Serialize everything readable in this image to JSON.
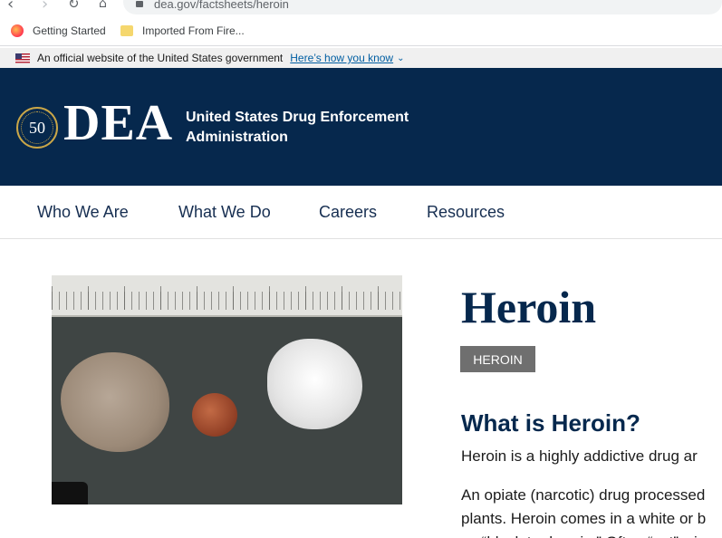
{
  "browser": {
    "url": "dea.gov/factsheets/heroin",
    "bookmarks": [
      {
        "label": "Getting Started",
        "icon": "firefox-icon"
      },
      {
        "label": "Imported From Fire...",
        "icon": "folder-icon"
      }
    ]
  },
  "gov_banner": {
    "text": "An official website of the United States government",
    "link": "Here’s how you know"
  },
  "header": {
    "seal_text": "50",
    "logo": "DEA",
    "agency_line1": "United States Drug Enforcement",
    "agency_line2": "Administration"
  },
  "nav": {
    "items": [
      "Who We Are",
      "What We Do",
      "Careers",
      "Resources"
    ]
  },
  "page": {
    "title": "Heroin",
    "tag": "HEROIN",
    "section_heading": "What is Heroin?",
    "paragraph1": "Heroin is a highly addictive drug ar",
    "paragraph2_line1": "An opiate (narcotic) drug processed",
    "paragraph2_line2": "plants. Heroin comes in a white or b",
    "paragraph2_line3": "as “black tar heroin.” Often “cut” wi"
  },
  "colors": {
    "header_bg": "#06284d",
    "nav_text": "#162e51",
    "link": "#005ea2",
    "tag_bg": "#6f6f6f"
  }
}
